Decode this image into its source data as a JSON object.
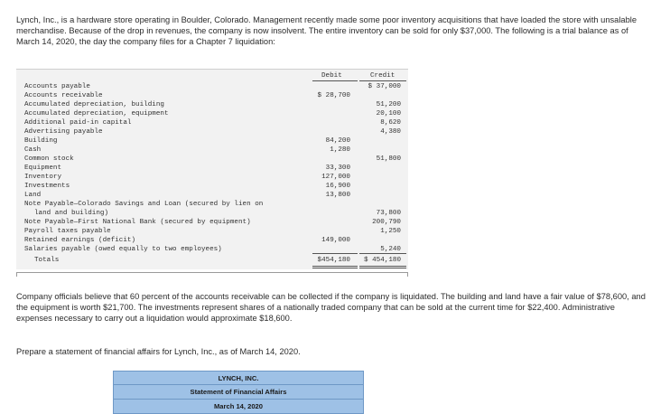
{
  "intro_text": "Lynch, Inc., is a hardware store operating in Boulder, Colorado. Management recently made some poor inventory acquisitions that have loaded the store with unsalable merchandise. Because of the drop in revenues, the company is now insolvent. The entire inventory can be sold for only $37,000. The following is a trial balance as of March 14, 2020, the day the company files for a Chapter 7 liquidation:",
  "trial_balance": {
    "debit_header": "Debit",
    "credit_header": "Credit",
    "rows": [
      {
        "label": "Accounts payable",
        "debit": "",
        "credit": "$ 37,000"
      },
      {
        "label": "Accounts receivable",
        "debit": "$ 28,700",
        "credit": ""
      },
      {
        "label": "Accumulated depreciation, building",
        "debit": "",
        "credit": "51,200"
      },
      {
        "label": "Accumulated depreciation, equipment",
        "debit": "",
        "credit": "20,100"
      },
      {
        "label": "Additional paid-in capital",
        "debit": "",
        "credit": "8,620"
      },
      {
        "label": "Advertising payable",
        "debit": "",
        "credit": "4,380"
      },
      {
        "label": "Building",
        "debit": "84,200",
        "credit": ""
      },
      {
        "label": "Cash",
        "debit": "1,280",
        "credit": ""
      },
      {
        "label": "Common stock",
        "debit": "",
        "credit": "51,800"
      },
      {
        "label": "Equipment",
        "debit": "33,300",
        "credit": ""
      },
      {
        "label": "Inventory",
        "debit": "127,000",
        "credit": ""
      },
      {
        "label": "Investments",
        "debit": "16,900",
        "credit": ""
      },
      {
        "label": "Land",
        "debit": "13,800",
        "credit": ""
      },
      {
        "label": "Note Payable—Colorado Savings and Loan (secured by lien on",
        "debit": "",
        "credit": ""
      },
      {
        "label": "land and building)",
        "debit": "",
        "credit": "73,800"
      },
      {
        "label": "Note Payable—First National Bank (secured by equipment)",
        "debit": "",
        "credit": "200,790"
      },
      {
        "label": "Payroll taxes payable",
        "debit": "",
        "credit": "1,250"
      },
      {
        "label": "Retained earnings (deficit)",
        "debit": "149,000",
        "credit": ""
      },
      {
        "label": "Salaries payable (owed equally to two employees)",
        "debit": "",
        "credit": "5,240"
      }
    ],
    "totals": {
      "label": "Totals",
      "debit": "$454,180",
      "credit": "$ 454,180"
    }
  },
  "officials_text": "Company officials believe that 60 percent of the accounts receivable can be collected if the company is liquidated. The building and land have a fair value of $78,600, and the equipment is worth $21,700. The investments represent shares of a nationally traded company that can be sold at the current time for $22,400. Administrative expenses necessary to carry out a liquidation would approximate $18,600.",
  "instruction_text": "Prepare a statement of financial affairs for Lynch, Inc., as of March 14, 2020.",
  "statement": {
    "company": "LYNCH, INC.",
    "title": "Statement of Financial Affairs",
    "date": "March 14, 2020"
  }
}
